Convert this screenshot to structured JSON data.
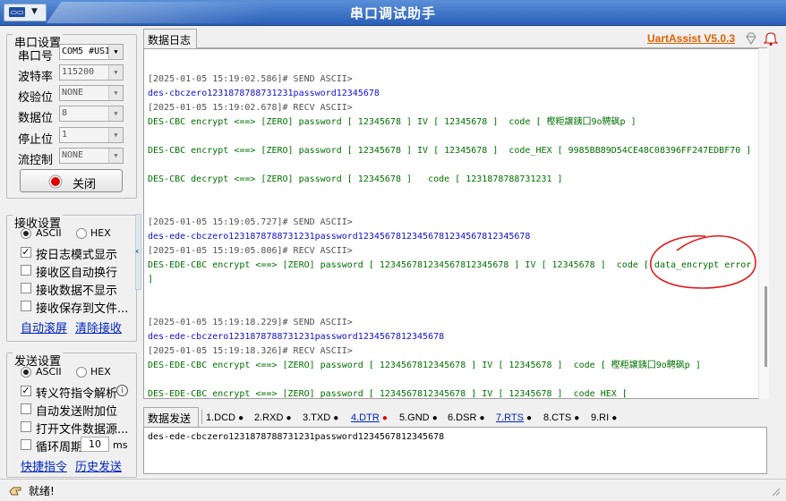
{
  "window": {
    "title": "串口调试助手",
    "sysmenu_icon": "serial-port-icon"
  },
  "serial": {
    "group_title": "串口设置",
    "fields": [
      {
        "label": "串口号",
        "value": "COM5 #USI"
      },
      {
        "label": "波特率",
        "value": "115200"
      },
      {
        "label": "校验位",
        "value": "NONE"
      },
      {
        "label": "数据位",
        "value": "8"
      },
      {
        "label": "停止位",
        "value": "1"
      },
      {
        "label": "流控制",
        "value": "NONE"
      }
    ],
    "close_button": "关闭",
    "status_light_color": "#e00000"
  },
  "receive": {
    "group_title": "接收设置",
    "radio_ascii": "ASCII",
    "radio_hex": "HEX",
    "opt_log_mode": "按日志模式显示",
    "opt_auto_wrap": "接收区自动换行",
    "opt_hide_data": "接收数据不显示",
    "opt_save_file": "接收保存到文件...",
    "link_auto_scroll": "自动滚屏",
    "link_clear": "清除接收"
  },
  "send": {
    "group_title": "发送设置",
    "radio_ascii": "ASCII",
    "radio_hex": "HEX",
    "opt_escape": "转义符指令解析",
    "opt_append": "自动发送附加位",
    "opt_open_file": "打开文件数据源...",
    "opt_cycle": "循环周期",
    "cycle_value": "10",
    "cycle_unit": "ms",
    "link_shortcut": "快捷指令",
    "link_history": "历史发送"
  },
  "header": {
    "log_tab": "数据日志",
    "brand": "UartAssist V5.0.3",
    "brand_color": "#e06000"
  },
  "log_lines": [
    {
      "text": "[2025-01-05 15:19:02.586]# SEND ASCII>",
      "kind": "meta"
    },
    {
      "text": "des-cbczero1231878788731231password12345678",
      "kind": "send"
    },
    {
      "text": "[2025-01-05 15:19:02.678]# RECV ASCII>",
      "kind": "meta"
    },
    {
      "text": "DES-CBC encrypt <==> [ZERO] password [ 12345678 ] IV [ 12345678 ]  code [ 樫粔譲銕囗9o騁砜p ]",
      "kind": "recv"
    },
    {
      "text": "",
      "kind": "recv"
    },
    {
      "text": "DES-CBC encrypt <==> [ZERO] password [ 12345678 ] IV [ 12345678 ]  code_HEX [ 9985BB89D54CE48C08396FF247EDBF70 ]",
      "kind": "recv"
    },
    {
      "text": "",
      "kind": "recv"
    },
    {
      "text": "DES-CBC decrypt <==> [ZERO] password [ 12345678 ]   code [ 1231878788731231 ]",
      "kind": "recv"
    },
    {
      "text": "",
      "kind": "recv"
    },
    {
      "text": "",
      "kind": "recv"
    },
    {
      "text": "[2025-01-05 15:19:05.727]# SEND ASCII>",
      "kind": "meta"
    },
    {
      "text": "des-ede-cbczero1231878788731231password12345678123456781234567812345678",
      "kind": "send"
    },
    {
      "text": "[2025-01-05 15:19:05.806]# RECV ASCII>",
      "kind": "meta"
    },
    {
      "text": "DES-EDE-CBC encrypt <==> [ZERO] password [ 123456781234567812345678 ] IV [ 12345678 ]  code [ data_encrypt error",
      "kind": "recv"
    },
    {
      "text": "]",
      "kind": "recv"
    },
    {
      "text": "",
      "kind": "recv"
    },
    {
      "text": "",
      "kind": "recv"
    },
    {
      "text": "[2025-01-05 15:19:18.229]# SEND ASCII>",
      "kind": "meta"
    },
    {
      "text": "des-ede-cbczero1231878788731231password1234567812345678",
      "kind": "send"
    },
    {
      "text": "[2025-01-05 15:19:18.326]# RECV ASCII>",
      "kind": "meta"
    },
    {
      "text": "DES-EDE-CBC encrypt <==> [ZERO] password [ 1234567812345678 ] IV [ 12345678 ]  code [ 樫粔譲銕囗9o騁砜p ]",
      "kind": "recv"
    },
    {
      "text": "",
      "kind": "recv"
    },
    {
      "text": "DES-EDE-CBC encrypt <==> [ZERO] password [ 1234567812345678 ] IV [ 12345678 ]  code_HEX [",
      "kind": "recv"
    }
  ],
  "sendbar": {
    "tab": "数据发送",
    "signals": [
      {
        "label": "1.DCD",
        "dot": "#000000",
        "link": false
      },
      {
        "label": "2.RXD",
        "dot": "#000000",
        "link": false
      },
      {
        "label": "3.TXD",
        "dot": "#000000",
        "link": false
      },
      {
        "label": "4.DTR",
        "dot": "#e00000",
        "link": true
      },
      {
        "label": "5.GND",
        "dot": "#000000",
        "link": false
      },
      {
        "label": "6.DSR",
        "dot": "#000000",
        "link": false
      },
      {
        "label": "7.RTS",
        "dot": "#000000",
        "link": true
      },
      {
        "label": "8.CTS",
        "dot": "#000000",
        "link": false
      },
      {
        "label": "9.RI",
        "dot": "#000000",
        "link": false
      }
    ],
    "input": "des-ede-cbczero1231878788731231password1234567812345678"
  },
  "status": {
    "text": "就绪!"
  }
}
